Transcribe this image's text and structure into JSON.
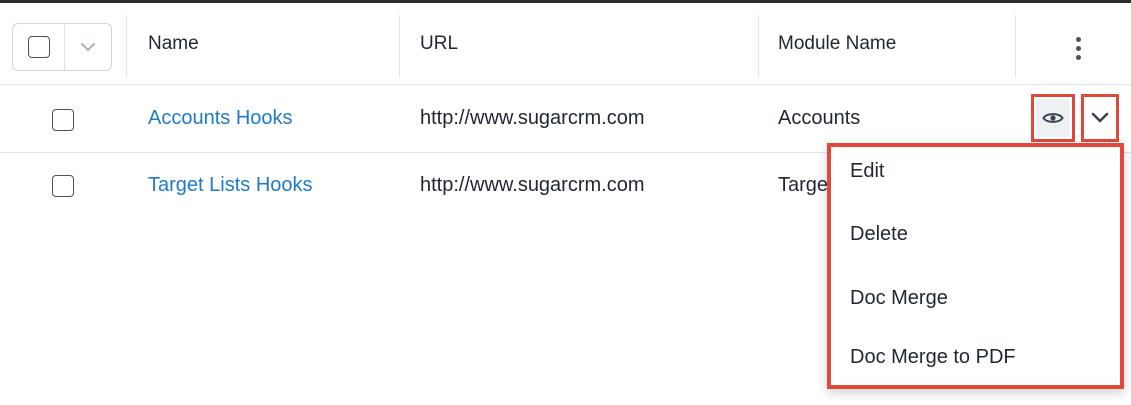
{
  "list": {
    "columns": {
      "name": "Name",
      "url": "URL",
      "module_name": "Module Name"
    },
    "rows": [
      {
        "name": "Accounts Hooks",
        "url": "http://www.sugarcrm.com",
        "module_name": "Accounts"
      },
      {
        "name": "Target Lists Hooks",
        "url": "http://www.sugarcrm.com",
        "module_name": "Targe"
      }
    ]
  },
  "row_actions": {
    "preview_icon": "eye-icon",
    "menu_icon": "chevron-down-icon",
    "menu": [
      "Edit",
      "Delete",
      "Doc Merge",
      "Doc Merge to PDF"
    ]
  },
  "colors": {
    "link": "#1f7ac8",
    "highlight": "#e0483a",
    "text": "#1f2733"
  }
}
